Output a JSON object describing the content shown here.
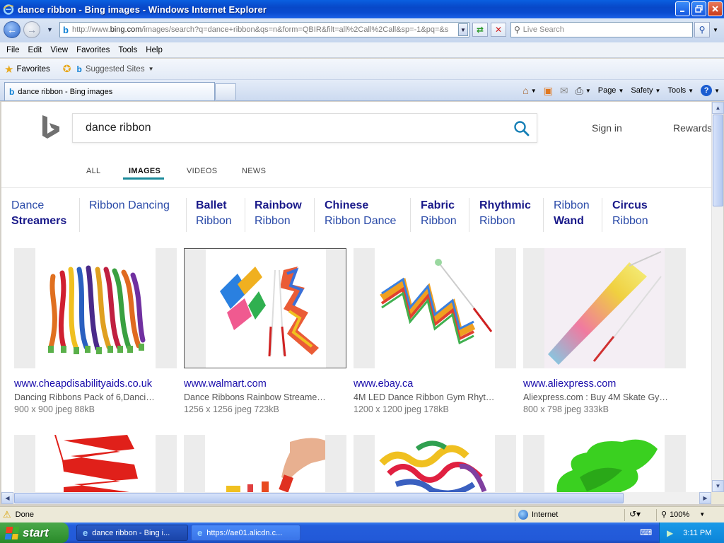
{
  "window": {
    "title": "dance ribbon - Bing images - Windows Internet Explorer"
  },
  "toolbar": {
    "address_url_prefix": "http://www.",
    "address_url_domain": "bing.com",
    "address_url_rest": "/images/search?q=dance+ribbon&qs=n&form=QBIR&filt=all%2Call%2Call&sp=-1&pq=&s",
    "live_search_placeholder": "Live Search"
  },
  "menu": [
    "File",
    "Edit",
    "View",
    "Favorites",
    "Tools",
    "Help"
  ],
  "favorites_bar": {
    "favorites_label": "Favorites",
    "suggested_label": "Suggested Sites"
  },
  "tab": {
    "label": "dance ribbon - Bing images"
  },
  "commands": {
    "page": "Page",
    "safety": "Safety",
    "tools": "Tools"
  },
  "bing": {
    "query": "dance ribbon",
    "sign_in": "Sign in",
    "rewards": "Rewards",
    "scopes": [
      "ALL",
      "IMAGES",
      "VIDEOS",
      "NEWS"
    ],
    "active_scope": "IMAGES"
  },
  "related": [
    {
      "l1": "Dance",
      "l2": "Streamers",
      "bold": 2
    },
    {
      "l1": "Ribbon Dancing",
      "l2": "",
      "bold": 0
    },
    {
      "l1": "Ballet",
      "l2": "Ribbon",
      "bold": 1
    },
    {
      "l1": "Rainbow",
      "l2": "Ribbon",
      "bold": 1
    },
    {
      "l1": "Chinese",
      "l2": "Ribbon Dance",
      "bold": 1
    },
    {
      "l1": "Fabric",
      "l2": "Ribbon",
      "bold": 1
    },
    {
      "l1": "Rhythmic",
      "l2": "Ribbon",
      "bold": 1
    },
    {
      "l1": "Ribbon",
      "l2": "Wand",
      "bold": 2
    },
    {
      "l1": "Circus",
      "l2": "Ribbon",
      "bold": 1
    }
  ],
  "results": [
    {
      "source": "www.cheapdisabilityaids.co.uk",
      "desc": "Dancing Ribbons Pack of 6,Danci…",
      "size": "900 x 900 jpeg 88kB"
    },
    {
      "source": "www.walmart.com",
      "desc": "Dance Ribbons Rainbow Streame…",
      "size": "1256 x 1256 jpeg 723kB"
    },
    {
      "source": "www.ebay.ca",
      "desc": "4M LED Dance Ribbon Gym Rhyt…",
      "size": "1200 x 1200 jpeg 178kB"
    },
    {
      "source": "www.aliexpress.com",
      "desc": "Aliexpress.com : Buy 4M Skate Gy…",
      "size": "800 x 798 jpeg 333kB"
    }
  ],
  "status": {
    "text": "Done",
    "zone": "Internet",
    "zoom": "100%"
  },
  "taskbar": {
    "start": "start",
    "item1": "dance ribbon - Bing i...",
    "item2": "https://ae01.alicdn.c...",
    "clock": "3:11 PM"
  }
}
